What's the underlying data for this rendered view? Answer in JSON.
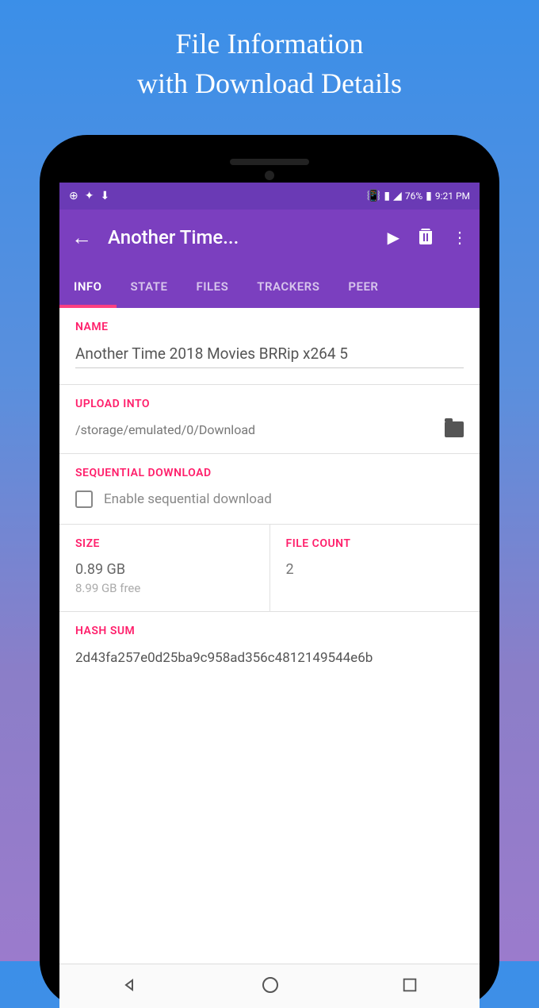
{
  "promo": {
    "line1": "File  Information",
    "line2": "with Download Details"
  },
  "statusBar": {
    "battery": "76%",
    "time": "9:21 PM"
  },
  "appBar": {
    "title": "Another Time..."
  },
  "tabs": {
    "info": "INFO",
    "state": "STATE",
    "files": "FILES",
    "trackers": "TRACKERS",
    "peers": "PEER"
  },
  "sections": {
    "name": {
      "label": "NAME",
      "value": "Another Time 2018 Movies BRRip x264 5"
    },
    "uploadInto": {
      "label": "UPLOAD INTO",
      "path": "/storage/emulated/0/Download"
    },
    "sequential": {
      "label": "SEQUENTIAL DOWNLOAD",
      "checkboxLabel": "Enable sequential download"
    },
    "size": {
      "label": "SIZE",
      "value": "0.89 GB",
      "free": "8.99 GB free"
    },
    "fileCount": {
      "label": "FILE COUNT",
      "value": "2"
    },
    "hash": {
      "label": "HASH SUM",
      "value": "2d43fa257e0d25ba9c958ad356c4812149544e6b"
    }
  }
}
